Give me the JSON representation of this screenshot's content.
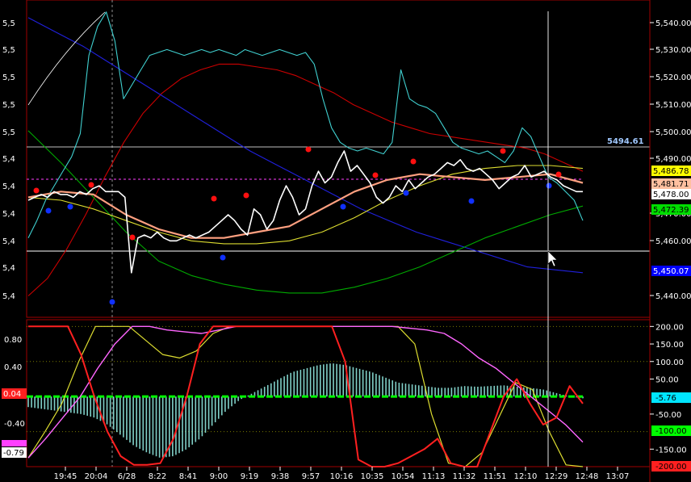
{
  "chart_data": [
    {
      "type": "line",
      "panel": "price",
      "left_axis_ticks": [
        "5,5",
        "5,5",
        "5,5",
        "5,5",
        "5,5",
        "5,4",
        "5,4",
        "5,4",
        "5,4",
        "5,4",
        "5,4"
      ],
      "right_axis_ticks": [
        "5,540.00",
        "5,530.00",
        "5,520.00",
        "5,510.00",
        "5,500.00",
        "5,490.00",
        "5,470.00",
        "5,460.00",
        "5,440.00"
      ],
      "crosshair_value": "5494.61",
      "badges": [
        {
          "label": "5,486.78",
          "bg": "#ffff00",
          "fg": "#000000"
        },
        {
          "label": "5,481.71",
          "bg": "#ffc0a0",
          "fg": "#000000"
        },
        {
          "label": "5,478.00",
          "bg": "#ffffff",
          "fg": "#000000"
        },
        {
          "label": "5,472.39",
          "bg": "#00dd00",
          "fg": "#000000"
        },
        {
          "label": "5,450.07",
          "bg": "#0000ff",
          "fg": "#ffffff"
        }
      ],
      "ylim": [
        5436,
        5543
      ],
      "series": [
        {
          "color": "#ffffff",
          "values": [
            5475,
            5476,
            5477,
            5476,
            5478,
            5477,
            5477,
            5476,
            5478,
            5477,
            5479,
            5480,
            5478,
            5478,
            5478,
            5476,
            5450,
            5462,
            5463,
            5462,
            5464,
            5462,
            5461,
            5461,
            5462,
            5463,
            5462,
            5463,
            5464,
            5466,
            5468,
            5470,
            5468,
            5465,
            5463,
            5472,
            5470,
            5465,
            5468,
            5475,
            5480,
            5476,
            5470,
            5472,
            5480,
            5485,
            5481,
            5483,
            5488,
            5492,
            5485,
            5487,
            5484,
            5481,
            5476,
            5474,
            5476,
            5480,
            5478,
            5482,
            5479,
            5481,
            5483,
            5484,
            5486,
            5488,
            5487,
            5489,
            5486,
            5485,
            5486,
            5484,
            5482,
            5479,
            5481,
            5483,
            5484,
            5487,
            5483,
            5484,
            5485,
            5483,
            5482,
            5480,
            5479,
            5478,
            5478
          ]
        },
        {
          "color": "#40d0d0",
          "values": [
            5462,
            5468,
            5475,
            5480,
            5485,
            5490,
            5498,
            5525,
            5535,
            5540,
            5530,
            5510,
            5515,
            5520,
            5525,
            5526,
            5527,
            5526,
            5525,
            5526,
            5527,
            5526,
            5527,
            5526,
            5525,
            5527,
            5526,
            5525,
            5526,
            5527,
            5526,
            5525,
            5526,
            5522,
            5510,
            5500,
            5495,
            5493,
            5492,
            5493,
            5492,
            5491,
            5495,
            5520,
            5510,
            5508,
            5507,
            5505,
            5500,
            5495,
            5493,
            5492,
            5491,
            5492,
            5490,
            5488,
            5492,
            5500,
            5497,
            5490,
            5483,
            5481,
            5478,
            5475,
            5468
          ]
        },
        {
          "color": "#cc0000",
          "values": [
            5442,
            5448,
            5458,
            5470,
            5483,
            5495,
            5505,
            5512,
            5517,
            5520,
            5522,
            5522,
            5521,
            5520,
            5518,
            5515,
            5512,
            5508,
            5505,
            5502,
            5500,
            5498,
            5497,
            5496,
            5495,
            5494,
            5493,
            5491,
            5488,
            5485
          ]
        },
        {
          "color": "#2020dd",
          "values": [
            5538,
            5533,
            5528,
            5522,
            5516,
            5510,
            5504,
            5498,
            5492,
            5487,
            5482,
            5477,
            5472,
            5468,
            5464,
            5461,
            5458,
            5455,
            5452,
            5451,
            5450
          ]
        },
        {
          "color": "#00aa00",
          "values": [
            5499,
            5488,
            5476,
            5464,
            5454,
            5449,
            5446,
            5444,
            5443,
            5443,
            5445,
            5448,
            5452,
            5457,
            5462,
            5466,
            5470,
            5473
          ]
        },
        {
          "color": "#dddd30",
          "values": [
            5476,
            5475,
            5472,
            5468,
            5464,
            5461,
            5460,
            5460,
            5461,
            5464,
            5469,
            5475,
            5480,
            5484,
            5486,
            5487,
            5487,
            5486
          ]
        },
        {
          "color": "#ffa080",
          "values": [
            5476,
            5478,
            5477,
            5470,
            5465,
            5462,
            5462,
            5464,
            5466,
            5472,
            5478,
            5482,
            5484,
            5483,
            5482,
            5483,
            5484,
            5481
          ]
        }
      ]
    },
    {
      "type": "line",
      "panel": "oscillator",
      "left_axis_ticks": [
        "0.80",
        "0.40",
        "0.04",
        "-0.40",
        "-0.79"
      ],
      "right_axis_ticks": [
        "200.00",
        "150.00",
        "100.00",
        "50.00",
        "-50.00",
        "-150.00"
      ],
      "badges": [
        {
          "label": "0.04",
          "bg": "#ff2020",
          "fg": "#ffffff"
        },
        {
          "label": "-0.79",
          "bg": "#ffffff",
          "fg": "#000000"
        },
        {
          "label": "-5.76",
          "bg": "#00e5ff",
          "fg": "#000000"
        },
        {
          "label": "-100.00",
          "bg": "#00ff00",
          "fg": "#000000"
        },
        {
          "label": "-200.00",
          "bg": "#ff2020",
          "fg": "#000000"
        }
      ],
      "ylim": [
        -200,
        210
      ],
      "series": [
        {
          "color": "#80d0c8",
          "values": [
            -30,
            -35,
            -40,
            -45,
            -50,
            -60,
            -80,
            -110,
            -140,
            -160,
            -175,
            -170,
            -150,
            -120,
            -80,
            -40,
            -10,
            10,
            30,
            50,
            70,
            80,
            90,
            95,
            90,
            80,
            70,
            55,
            40,
            35,
            30,
            25,
            25,
            30,
            28,
            30,
            32,
            28,
            25,
            20,
            10,
            0,
            -5
          ]
        },
        {
          "color": "#ff2020",
          "values": [
            200,
            200,
            200,
            200,
            120,
            0,
            -100,
            -170,
            -195,
            -195,
            -190,
            -120,
            0,
            150,
            200,
            200,
            200,
            200,
            200,
            200,
            200,
            200,
            200,
            200,
            100,
            -180,
            -200,
            -200,
            -190,
            -170,
            -150,
            -120,
            -190,
            -200,
            -200,
            -100,
            0,
            50,
            -20,
            -80,
            -60,
            30,
            -20
          ]
        },
        {
          "color": "#ff66ff",
          "values": [
            -175,
            -120,
            -60,
            0,
            80,
            150,
            200,
            200,
            190,
            185,
            180,
            190,
            200,
            200,
            200,
            200,
            200,
            200,
            200,
            200,
            200,
            200,
            195,
            190,
            180,
            150,
            110,
            80,
            40,
            0,
            -40,
            -80,
            -130
          ]
        },
        {
          "color": "#dddd30",
          "values": [
            -175,
            -100,
            -20,
            100,
            200,
            200,
            200,
            160,
            120,
            110,
            130,
            180,
            200,
            200,
            200,
            200,
            200,
            200,
            200,
            200,
            200,
            200,
            200,
            150,
            -50,
            -190,
            -200,
            -160,
            -60,
            40,
            20,
            -100,
            -195,
            -200
          ]
        }
      ]
    }
  ],
  "time_axis": [
    "19:45",
    "20:04",
    "6/28",
    "8:22",
    "8:41",
    "9:00",
    "9:19",
    "9:38",
    "9:57",
    "10:16",
    "10:35",
    "10:54",
    "11:13",
    "11:32",
    "11:51",
    "12:10",
    "12:29",
    "12:48",
    "13:07"
  ],
  "colors": {
    "background": "#000000",
    "grid": "#a00000",
    "crosshair": "#ffffff"
  }
}
